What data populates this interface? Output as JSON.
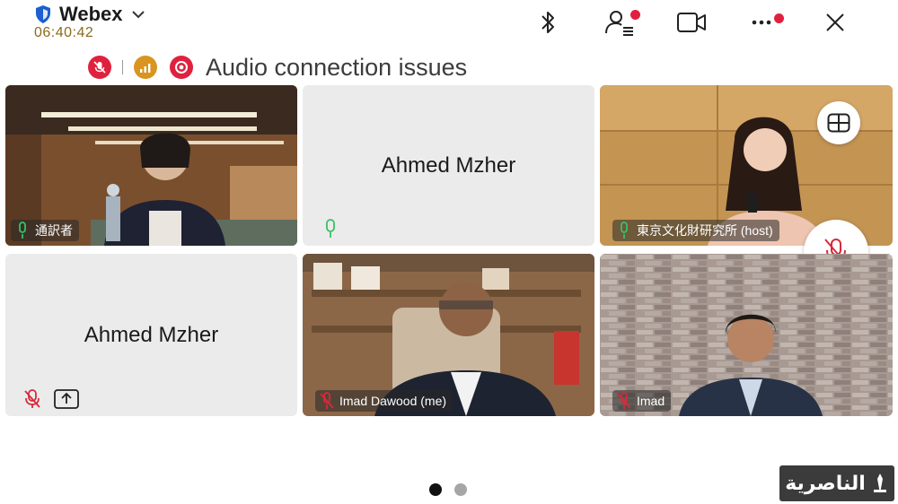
{
  "header": {
    "app_name": "Webex",
    "timer": "06:40:42"
  },
  "icons": {
    "shield": "shield-icon",
    "chevron": "chevron-down-icon",
    "bluetooth": "bluetooth-icon",
    "participants": "participants-icon",
    "video": "video-camera-icon",
    "more": "more-options-icon",
    "close": "close-icon",
    "muted": "microphone-muted-icon",
    "mic": "microphone-icon",
    "stats": "network-stats-icon",
    "record": "recording-icon",
    "layout": "layout-grid-icon",
    "share": "share-screen-icon"
  },
  "status": {
    "issue_text": "Audio connection issues"
  },
  "tiles": [
    {
      "label": "通訳者",
      "audio": "unmuted",
      "active": true
    },
    {
      "center_name": "Ahmed Mzher",
      "audio": "unmuted"
    },
    {
      "label": "東京文化財研究所 (host)",
      "audio": "unmuted"
    },
    {
      "center_name": "Ahmed Mzher",
      "audio": "muted",
      "sharing": true
    },
    {
      "label": "Imad Dawood (me)",
      "audio": "muted"
    },
    {
      "label": "Imad",
      "audio": "muted"
    }
  ],
  "pagination": {
    "current_page": 1,
    "total_pages": 2
  },
  "watermark": {
    "text": "الناصرية"
  },
  "colors": {
    "accent": "#54cdb7",
    "alert_red": "#e0213d",
    "stats_orange": "#d9951f",
    "mic_green": "#38c06a",
    "mute_red": "#d62a3a",
    "timer": "#8a6a1c",
    "tile_bg": "#ebebeb"
  }
}
